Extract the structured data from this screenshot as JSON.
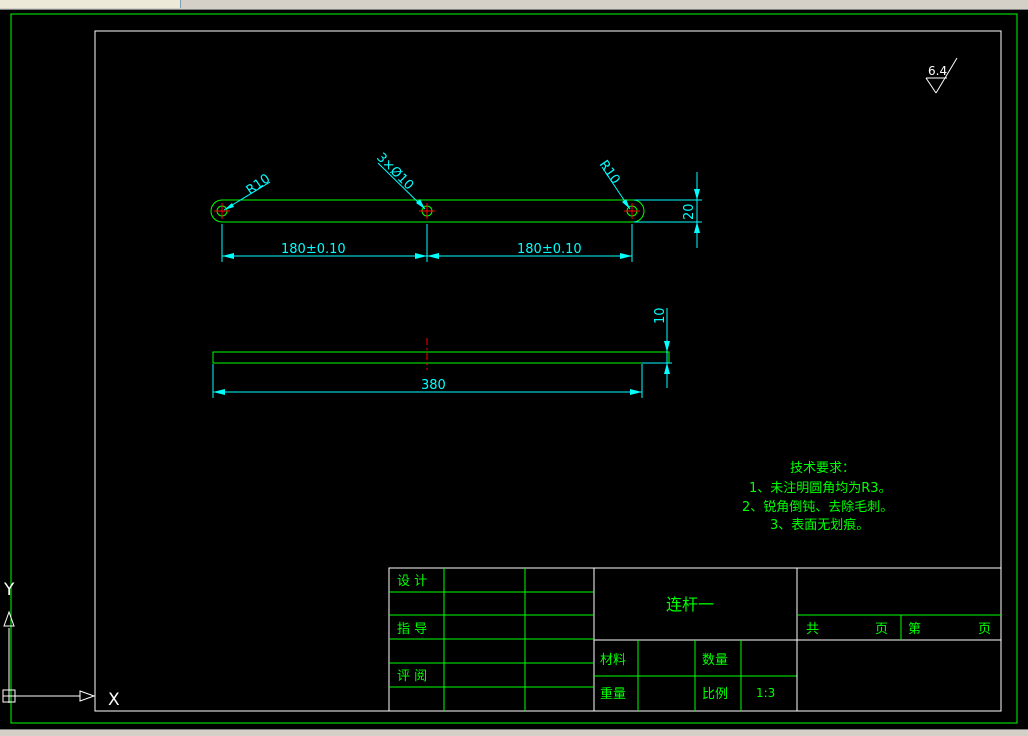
{
  "colors": {
    "background": "#000000",
    "frame": "#00ff00",
    "dimension": "#00ffff",
    "centerline": "#ff0000",
    "text": "#00ff00",
    "white": "#ffffff"
  },
  "surface_finish": "6.4",
  "annotations": {
    "r10_left": "R10",
    "holes": "3×Ø10",
    "r10_right": "R10",
    "thickness": "20",
    "dim_left": "180±0.10",
    "dim_right": "180±0.10",
    "height_10": "10",
    "length": "380"
  },
  "tech": {
    "title": "技术要求：",
    "lines": [
      "1、未注明圆角均为R3。",
      "2、锐角倒钝、去除毛刺。",
      "3、表面无划痕。"
    ]
  },
  "title_block": {
    "design": "设 计",
    "guide": "指 导",
    "review": "评 阅",
    "part_name": "连杆一",
    "material": "材料",
    "quantity": "数量",
    "weight": "重量",
    "scale_label": "比例",
    "scale_value": "1:3",
    "total": "共",
    "page_unit_1": "页",
    "sheet": "第",
    "page_unit_2": "页"
  },
  "ucs": {
    "x_label": "X",
    "y_label": "Y"
  }
}
